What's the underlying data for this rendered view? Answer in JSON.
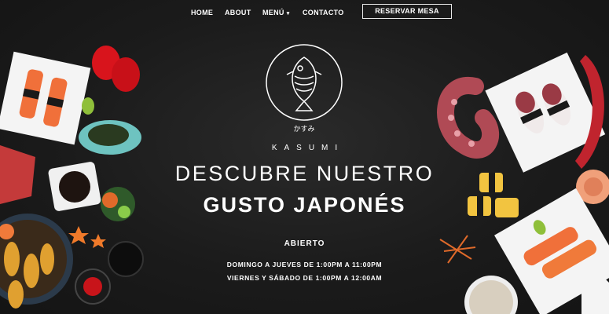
{
  "nav": {
    "home": "HOME",
    "about": "ABOUT",
    "menu": "MENÚ",
    "contact": "CONTACTO",
    "reserve": "RESERVAR MESA"
  },
  "brand": {
    "kana": "かすみ",
    "name": "KASUMI"
  },
  "hero": {
    "line1": "DESCUBRE NUESTRO",
    "line2": "GUSTO JAPONÉS"
  },
  "hours": {
    "status": "ABIERTO",
    "line1": "DOMINGO A JUEVES DE 1:00PM A 11:00PM",
    "line2": "VIERNES Y SÁBADO DE 1:00PM A 12:00AM"
  },
  "colors": {
    "background": "#1b1b1b",
    "text": "#ffffff",
    "salmon": "#f0703a",
    "roe": "#d8141c",
    "plate": "#f4f4f4",
    "octopus": "#b04a55"
  }
}
